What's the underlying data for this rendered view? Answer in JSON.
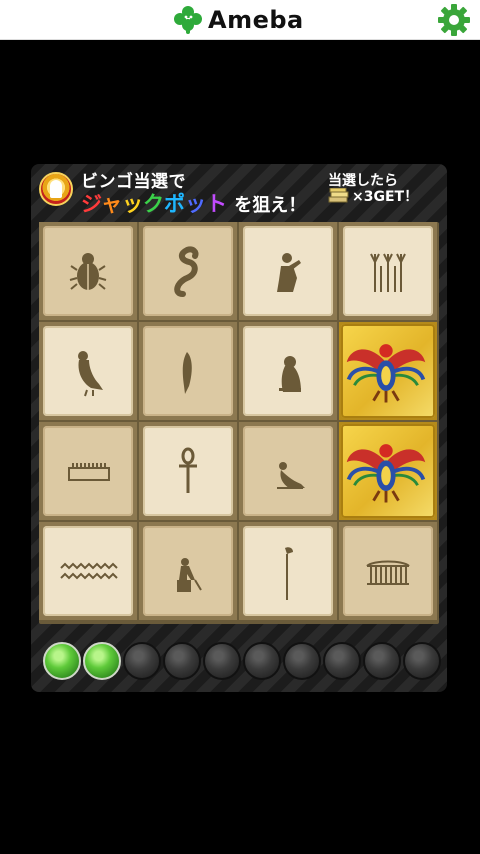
{
  "header": {
    "logo_text": "Ameba",
    "logo_icon": "ameba-clover-icon",
    "settings_icon": "gear-icon"
  },
  "banner": {
    "line1": "ビンゴ当選で",
    "jackpot_chars": [
      "ジ",
      "ャ",
      "ッ",
      "ク",
      "ポ",
      "ッ",
      "ト"
    ],
    "line2_suffix": "を狙え！",
    "prize_line1": "当選したら",
    "prize_line2": "×3GET！"
  },
  "board": {
    "tiles": [
      {
        "symbol": "scarab-glyph-icon",
        "state": "unopened"
      },
      {
        "symbol": "cobra-glyph-icon",
        "state": "unopened"
      },
      {
        "symbol": "seated-figure-glyph-icon",
        "state": "unopened"
      },
      {
        "symbol": "reeds-glyph-icon",
        "state": "unopened"
      },
      {
        "symbol": "vulture-glyph-icon",
        "state": "unopened"
      },
      {
        "symbol": "feather-glyph-icon",
        "state": "unopened"
      },
      {
        "symbol": "owl-glyph-icon",
        "state": "unopened"
      },
      {
        "symbol": "winged-scarab-icon",
        "state": "revealed"
      },
      {
        "symbol": "game-board-glyph-icon",
        "state": "unopened"
      },
      {
        "symbol": "ankh-glyph-icon",
        "state": "unopened"
      },
      {
        "symbol": "falcon-glyph-icon",
        "state": "unopened"
      },
      {
        "symbol": "winged-scarab-icon",
        "state": "revealed"
      },
      {
        "symbol": "water-glyph-icon",
        "state": "unopened"
      },
      {
        "symbol": "seated-god-glyph-icon",
        "state": "unopened"
      },
      {
        "symbol": "staff-bird-glyph-icon",
        "state": "unopened"
      },
      {
        "symbol": "shrine-glyph-icon",
        "state": "unopened"
      }
    ]
  },
  "stones": {
    "total": 10,
    "collected": 2,
    "collected_color": "#5fca3a",
    "empty_color": "#3a3a3a"
  },
  "colors": {
    "gold": "#e3b52a",
    "tile_dark": "#dcc9a3",
    "tile_light": "#efe3c9",
    "glyph": "#6b5a38"
  }
}
